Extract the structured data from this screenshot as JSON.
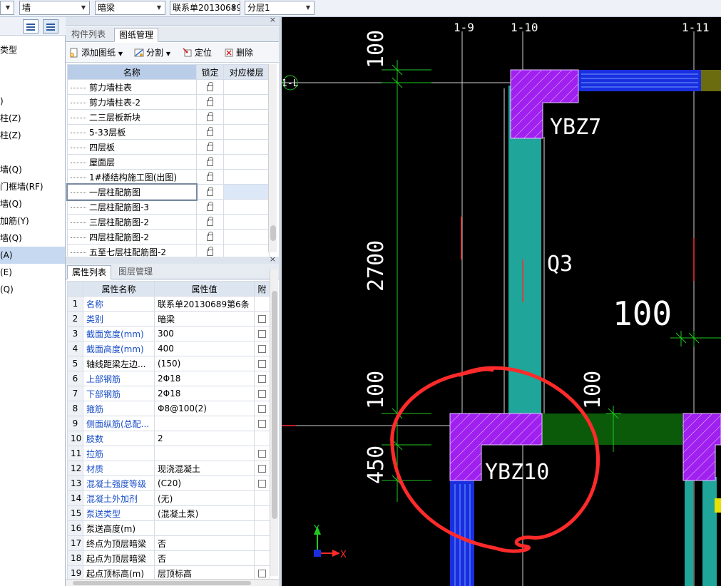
{
  "topbar": {
    "combo1": "",
    "combo2": "墙",
    "combo3": "暗梁",
    "combo4": "联系单20130689",
    "combo5": "分层1"
  },
  "left_strip": {
    "items": [
      "类型",
      ")",
      "柱(Z)",
      "柱(Z)",
      "墙(Q)",
      "门框墙(RF)",
      "墙(Q)",
      "加筋(Y)",
      "墙(Q)",
      "(A)",
      "(E)",
      "(Q)"
    ],
    "selected_index": 9
  },
  "drawing_panel": {
    "tabs": [
      "构件列表",
      "图纸管理"
    ],
    "active_tab": 1,
    "toolbar": {
      "add": "添加图纸",
      "split": "分割",
      "locate": "定位",
      "delete": "删除"
    },
    "columns": [
      "名称",
      "锁定",
      "对应楼层"
    ],
    "rows": [
      "剪力墙柱表",
      "剪力墙柱表-2",
      "二三层板新块",
      "5-33层板",
      "四层板",
      "屋面层",
      "1#楼结构施工图(出图)",
      "一层柱配筋图",
      "二层柱配筋图-3",
      "三层柱配筋图-2",
      "四层柱配筋图-2",
      "五至七层柱配筋图-2"
    ],
    "selected_row": 7
  },
  "props_panel": {
    "tabs": [
      "属性列表",
      "图层管理"
    ],
    "active_tab": 0,
    "columns": [
      "属性名称",
      "属性值",
      "附"
    ],
    "rows": [
      {
        "num": "1",
        "name": "名称",
        "value": "联系单20130689第6条",
        "blue": true,
        "check": false
      },
      {
        "num": "2",
        "name": "类别",
        "value": "暗梁",
        "blue": true,
        "check": true
      },
      {
        "num": "3",
        "name": "截面宽度(mm)",
        "value": "300",
        "blue": true,
        "check": true
      },
      {
        "num": "4",
        "name": "截面高度(mm)",
        "value": "400",
        "blue": true,
        "check": true
      },
      {
        "num": "5",
        "name": "轴线距梁左边...",
        "value": "(150)",
        "blue": false,
        "check": true
      },
      {
        "num": "6",
        "name": "上部钢筋",
        "value": "2Φ18",
        "blue": true,
        "check": true
      },
      {
        "num": "7",
        "name": "下部钢筋",
        "value": "2Φ18",
        "blue": true,
        "check": true
      },
      {
        "num": "8",
        "name": "箍筋",
        "value": "Φ8@100(2)",
        "blue": true,
        "check": true
      },
      {
        "num": "9",
        "name": "侧面纵筋(总配...",
        "value": "",
        "blue": true,
        "check": true
      },
      {
        "num": "10",
        "name": "肢数",
        "value": "2",
        "blue": true,
        "check": false
      },
      {
        "num": "11",
        "name": "拉筋",
        "value": "",
        "blue": true,
        "check": true
      },
      {
        "num": "12",
        "name": "材质",
        "value": "现浇混凝土",
        "blue": true,
        "check": true
      },
      {
        "num": "13",
        "name": "混凝土强度等级",
        "value": "(C20)",
        "blue": true,
        "check": true
      },
      {
        "num": "14",
        "name": "混凝土外加剂",
        "value": "(无)",
        "blue": true,
        "check": false
      },
      {
        "num": "15",
        "name": "泵送类型",
        "value": "(混凝土泵)",
        "blue": true,
        "check": false
      },
      {
        "num": "16",
        "name": "泵送高度(m)",
        "value": "",
        "blue": false,
        "check": false
      },
      {
        "num": "17",
        "name": "终点为顶层暗梁",
        "value": "否",
        "blue": false,
        "check": false
      },
      {
        "num": "18",
        "name": "起点为顶层暗梁",
        "value": "否",
        "blue": false,
        "check": false
      },
      {
        "num": "19",
        "name": "起点顶标高(m)",
        "value": "层顶标高",
        "blue": false,
        "check": true
      }
    ]
  },
  "cad": {
    "axes": [
      "1-9",
      "1-10",
      "1-11",
      "1-L"
    ],
    "labels": {
      "ybz7": "YBZ7",
      "ybz10": "YBZ10",
      "q3": "Q3",
      "dim_100_top": "100",
      "dim_2700": "2700",
      "dim_100_mid": "100",
      "dim_450": "450",
      "dim_100_big": "100",
      "dim_100_right": "100"
    },
    "ucs": {
      "x": "X",
      "y": "Y"
    },
    "colors": {
      "column": "#a020f0",
      "wall": "#1fa59a",
      "beam_green": "#0a5a0a",
      "beam_blue": "#1a2ee0",
      "annotation": "#ff2a2a",
      "axis_line": "#cfcfcf",
      "dim": "#1fc81f"
    }
  }
}
